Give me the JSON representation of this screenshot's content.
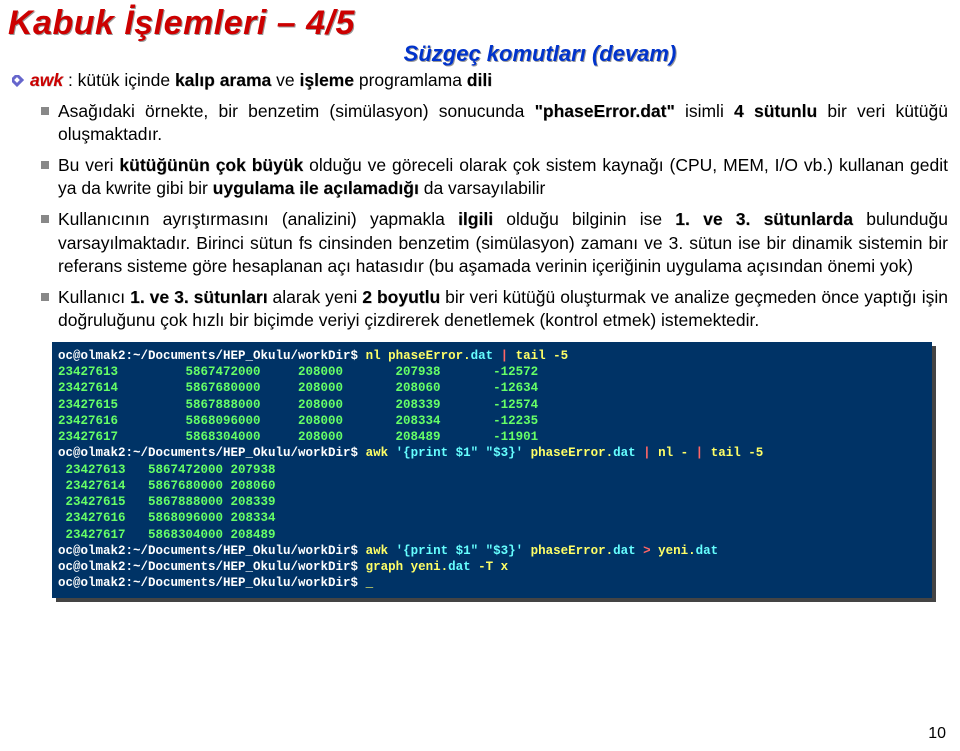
{
  "title": "Kabuk İşlemleri – 4/5",
  "subtitle": "Süzgeç komutları (devam)",
  "bullet1": {
    "awk": "awk",
    "t1": " : kütük içinde ",
    "kalip_arama": "kalıp arama",
    "t2": " ve ",
    "isleme": "işleme",
    "t3": " programlama ",
    "dili": "dili"
  },
  "bullet2": {
    "t1": "Asağıdaki örnekte, bir benzetim (simülasyon) sonucunda ",
    "phase": "\"phaseError.dat\"",
    "t2": " isimli ",
    "four": "4 sütunlu",
    "t3": " bir veri kütüğü oluşmaktadır."
  },
  "bullet3": {
    "t1": "Bu veri ",
    "k1": "kütüğünün çok büyük",
    "t2": " olduğu ve göreceli olarak çok sistem kaynağı (CPU, MEM, I/O vb.) kullanan gedit ya da kwrite gibi bir ",
    "k2": "uygulama ile açılamadığı",
    "t3": " da varsayılabilir"
  },
  "bullet4": {
    "t1": "Kullanıcının ayrıştırmasını (analizini) yapmakla ",
    "k1": "ilgili",
    "t2": " olduğu bilginin ise ",
    "k2": "1. ve 3. sütunlarda",
    "t3": " bulunduğu varsayılmaktadır. Birinci sütun fs cinsinden benzetim (simülasyon) zamanı ve 3. sütun ise bir dinamik sistemin bir referans sisteme göre hesaplanan açı hatasıdır (bu aşamada verinin içeriğinin uygulama açısından önemi yok)"
  },
  "bullet5": {
    "t1": "Kullanıcı ",
    "k1": "1. ve 3. sütunları",
    "t2": " alarak yeni ",
    "k2": "2 boyutlu",
    "t3": " bir veri kütüğü oluşturmak ve analize geçmeden önce yaptığı işin doğruluğunu çok hızlı bir biçimde veriyi çizdirerek denetlemek (kontrol etmek) istemektedir."
  },
  "terminal": {
    "l1_prompt": "oc@olmak2:~/Documents/HEP_Okulu/workDir$ ",
    "l1_cmd": "nl phaseError.",
    "l1_dat": "dat",
    "l1_pipe": " | ",
    "l1_tail": "tail -5",
    "r1": "23427613         5867472000     208000       207938       -12572",
    "r2": "23427614         5867680000     208000       208060       -12634",
    "r3": "23427615         5867888000     208000       208339       -12574",
    "r4": "23427616         5868096000     208000       208334       -12235",
    "r5": "23427617         5868304000     208000       208489       -11901",
    "l2_prompt": "oc@olmak2:~/Documents/HEP_Okulu/workDir$ ",
    "l2_awk": "awk ",
    "l2_args": "'{print $1\" \"$3}'",
    "l2_file": " phaseError.",
    "l2_dat": "dat",
    "l2_p1": " | ",
    "l2_nl": "nl - ",
    "l2_p2": "| ",
    "l2_tail": "tail -5",
    "rr1": " 23427613   5867472000 207938",
    "rr2": " 23427614   5867680000 208060",
    "rr3": " 23427615   5867888000 208339",
    "rr4": " 23427616   5868096000 208334",
    "rr5": " 23427617   5868304000 208489",
    "l3_prompt": "oc@olmak2:~/Documents/HEP_Okulu/workDir$ ",
    "l3_awk": "awk ",
    "l3_args": "'{print $1\" \"$3}'",
    "l3_file": " phaseError.",
    "l3_dat": "dat",
    "l3_gt": " > ",
    "l3_yeni": "yeni.",
    "l3_dat2": "dat",
    "l4_prompt": "oc@olmak2:~/Documents/HEP_Okulu/workDir$ ",
    "l4_graph": "graph ",
    "l4_yeni": "yeni.",
    "l4_dat": "dat",
    "l4_args": " -T x",
    "l5_prompt": "oc@olmak2:~/Documents/HEP_Okulu/workDir$ ",
    "l5_cursor": "_"
  },
  "pagenum": "10"
}
